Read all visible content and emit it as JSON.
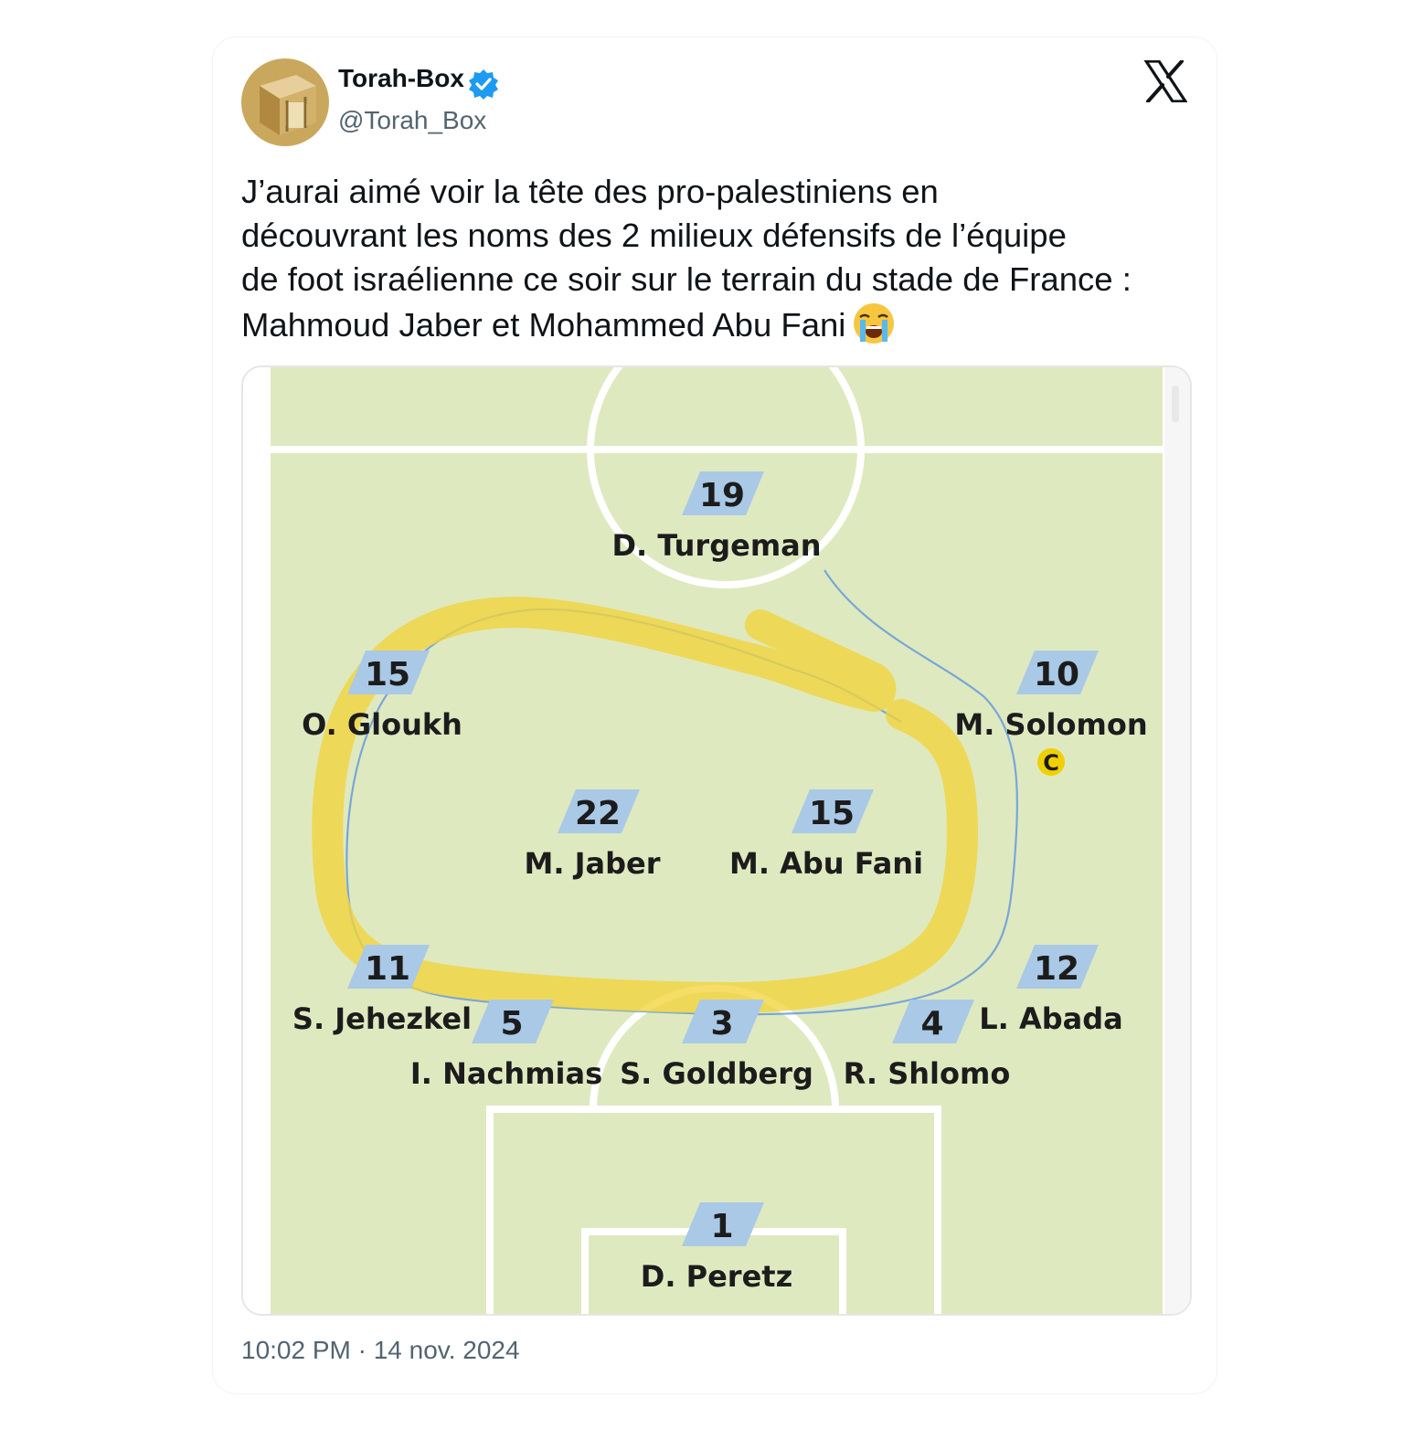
{
  "tweet": {
    "author": {
      "display_name": "Torah-Box",
      "handle": "@Torah_Box",
      "verified": true
    },
    "text_lines": [
      "J’aurai aimé voir la tête des pro-palestiniens en",
      "découvrant les noms des 2 milieux défensifs de l’équipe",
      "de foot israélienne ce soir sur le terrain du stade de France :",
      "Mahmoud Jaber et Mohammed Abu Fani"
    ],
    "emoji": "loudly-crying-face",
    "timestamp": "10:02 PM · 14 nov. 2024",
    "platform_logo": "x-logo"
  },
  "lineup": {
    "players": [
      {
        "number": "19",
        "name": "D. Turgeman"
      },
      {
        "number": "15",
        "name": "O. Gloukh"
      },
      {
        "number": "10",
        "name": "M. Solomon",
        "captain_badge": "C"
      },
      {
        "number": "22",
        "name": "M. Jaber",
        "highlighted": true
      },
      {
        "number": "15",
        "name": "M. Abu Fani",
        "highlighted": true
      },
      {
        "number": "11",
        "name": "S. Jehezkel"
      },
      {
        "number": "12",
        "name": "L. Abada"
      },
      {
        "number": "5",
        "name": "I. Nachmias"
      },
      {
        "number": "3",
        "name": "S. Goldberg"
      },
      {
        "number": "4",
        "name": "R. Shlomo"
      },
      {
        "number": "1",
        "name": "D. Peretz"
      }
    ]
  },
  "colors": {
    "pitch": "#dfe9c0",
    "pitch_lines": "#ffffff",
    "number_badge": "#a9c9e6",
    "highlight_marker": "#f2d43b",
    "captain_badge": "#f0d000",
    "verified": "#1d9bf0",
    "text_primary": "#0f1419",
    "text_secondary": "#536471"
  }
}
